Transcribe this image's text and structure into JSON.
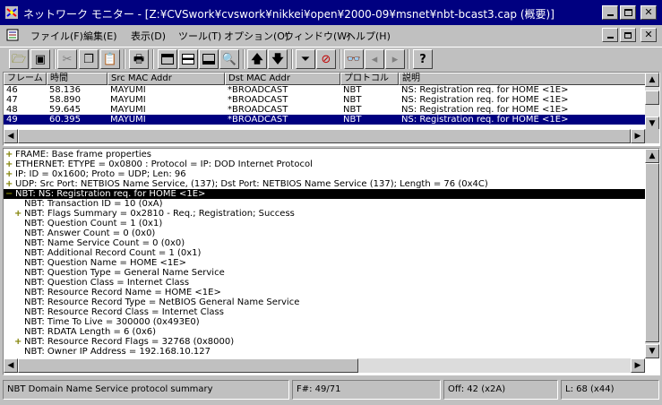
{
  "window": {
    "title": "ネットワーク モニター - [Z:¥CVSwork¥cvswork¥nikkei¥open¥2000-09¥msnet¥nbt-bcast3.cap (概要)]"
  },
  "menu": [
    "ファイル(F)",
    "編集(E)",
    "表示(D)",
    "ツール(T)",
    "オプション(O)",
    "ウィンドウ(W)",
    "ヘルプ(H)"
  ],
  "summary": {
    "columns": [
      "フレーム",
      "時間",
      "Src MAC Addr",
      "Dst MAC Addr",
      "プロトコル",
      "説明"
    ],
    "rows": [
      {
        "frame": "46",
        "time": "58.136",
        "src": "MAYUMI",
        "dst": "*BROADCAST",
        "protocol": "NBT",
        "desc": "NS: Registration req. for HOME          <1E>",
        "selected": false
      },
      {
        "frame": "47",
        "time": "58.890",
        "src": "MAYUMI",
        "dst": "*BROADCAST",
        "protocol": "NBT",
        "desc": "NS: Registration req. for HOME          <1E>",
        "selected": false
      },
      {
        "frame": "48",
        "time": "59.645",
        "src": "MAYUMI",
        "dst": "*BROADCAST",
        "protocol": "NBT",
        "desc": "NS: Registration req. for HOME          <1E>",
        "selected": false
      },
      {
        "frame": "49",
        "time": "60.395",
        "src": "MAYUMI",
        "dst": "*BROADCAST",
        "protocol": "NBT",
        "desc": "NS: Registration req. for HOME          <1E>",
        "selected": true
      }
    ]
  },
  "detail": [
    {
      "text": "FRAME: Base frame properties",
      "expander": "+",
      "level": 0
    },
    {
      "text": "ETHERNET: ETYPE = 0x0800 : Protocol = IP:  DOD Internet Protocol",
      "expander": "+",
      "level": 0
    },
    {
      "text": "IP: ID = 0x1600; Proto = UDP; Len: 96",
      "expander": "+",
      "level": 0
    },
    {
      "text": "UDP: Src Port: NETBIOS Name Service, (137); Dst Port: NETBIOS Name Service (137); Length = 76 (0x4C)",
      "expander": "+",
      "level": 0
    },
    {
      "text": "NBT: NS: Registration req. for HOME          <1E>",
      "expander": "-",
      "level": 0,
      "selected": true
    },
    {
      "text": "NBT: Transaction ID = 10 (0xA)",
      "expander": "",
      "level": 1
    },
    {
      "text": "NBT: Flags Summary = 0x2810 - Req.; Registration; Success",
      "expander": "+",
      "level": 1
    },
    {
      "text": "NBT: Question Count = 1 (0x1)",
      "expander": "",
      "level": 1
    },
    {
      "text": "NBT: Answer Count = 0 (0x0)",
      "expander": "",
      "level": 1
    },
    {
      "text": "NBT: Name Service Count = 0 (0x0)",
      "expander": "",
      "level": 1
    },
    {
      "text": "NBT: Additional Record Count = 1 (0x1)",
      "expander": "",
      "level": 1
    },
    {
      "text": "NBT: Question Name = HOME          <1E>",
      "expander": "",
      "level": 1
    },
    {
      "text": "NBT: Question Type = General Name Service",
      "expander": "",
      "level": 1
    },
    {
      "text": "NBT: Question Class = Internet Class",
      "expander": "",
      "level": 1
    },
    {
      "text": "NBT: Resource Record Name = HOME          <1E>",
      "expander": "",
      "level": 1
    },
    {
      "text": "NBT: Resource Record Type = NetBIOS General Name Service",
      "expander": "",
      "level": 1
    },
    {
      "text": "NBT: Resource Record Class = Internet Class",
      "expander": "",
      "level": 1
    },
    {
      "text": "NBT: Time To Live = 300000 (0x493E0)",
      "expander": "",
      "level": 1
    },
    {
      "text": "NBT: RDATA Length = 6 (0x6)",
      "expander": "",
      "level": 1
    },
    {
      "text": "NBT: Resource Record Flags = 32768 (0x8000)",
      "expander": "+",
      "level": 1
    },
    {
      "text": "NBT: Owner IP Address = 192.168.10.127",
      "expander": "",
      "level": 1
    }
  ],
  "status": {
    "summary": "NBT Domain Name Service protocol summary",
    "frame": "F#: 49/71",
    "offset": "Off: 42 (x2A)",
    "length": "L: 68 (x44)"
  },
  "colors": {
    "titlebar": "#000080",
    "selection": "#000080",
    "detail_selection": "#000000",
    "face": "#c0c0c0",
    "expander": "#808000"
  }
}
